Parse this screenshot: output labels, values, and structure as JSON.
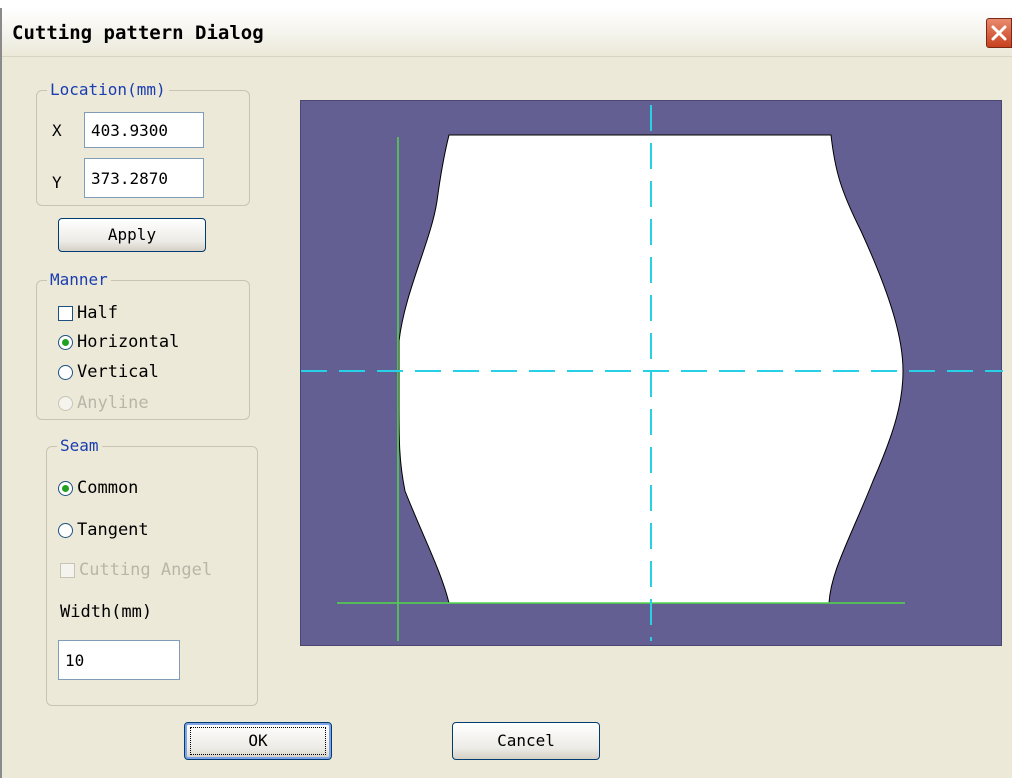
{
  "window": {
    "title": "Cutting pattern Dialog"
  },
  "location": {
    "label": "Location(mm)",
    "x_label": "X",
    "x_value": "403.9300",
    "y_label": "Y",
    "y_value": "373.2870",
    "apply_label": "Apply"
  },
  "manner": {
    "label": "Manner",
    "half": "Half",
    "horizontal": "Horizontal",
    "vertical": "Vertical",
    "anyline": "Anyline",
    "selected": "horizontal"
  },
  "seam": {
    "label": "Seam",
    "common": "Common",
    "tangent": "Tangent",
    "cutting_angel": "Cutting Angel",
    "width_label": "Width(mm)",
    "width_value": "10",
    "selected": "common"
  },
  "buttons": {
    "ok": "OK",
    "cancel": "Cancel"
  },
  "colors": {
    "canvas_bg": "#635f92",
    "shape_fill": "#ffffff",
    "guide_green": "#4fd84a",
    "axis_cyan": "#28d0e6",
    "group_label": "#1a3db0"
  },
  "icons": {
    "close": "close-icon"
  }
}
